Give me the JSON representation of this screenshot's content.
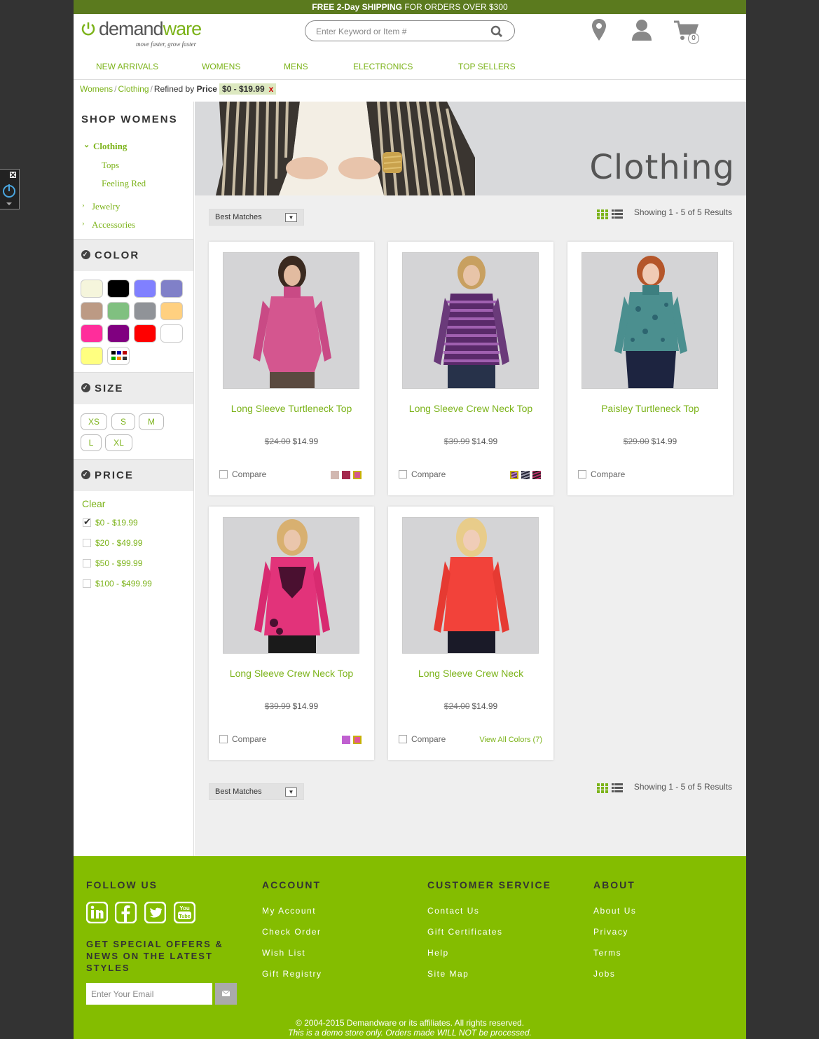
{
  "promo": {
    "bold": "FREE 2-Day SHIPPING",
    "rest": " FOR ORDERS OVER $300"
  },
  "logo": {
    "word_a": "demand",
    "word_b": "ware",
    "tagline": "move faster, grow faster"
  },
  "search": {
    "placeholder": "Enter Keyword or Item #"
  },
  "cart": {
    "count": "0"
  },
  "nav": [
    "NEW ARRIVALS",
    "WOMENS",
    "MENS",
    "ELECTRONICS",
    "TOP SELLERS"
  ],
  "breadcrumb": {
    "c1": "Womens",
    "c2": "Clothing",
    "refined": "Refined by",
    "by": "Price",
    "chip": "$0 - $19.99",
    "chip_x": "x"
  },
  "sidebar": {
    "shop_title": "SHOP WOMENS",
    "categories": {
      "clothing": "Clothing",
      "tops": "Tops",
      "feeling_red": "Feeling Red",
      "jewelry": "Jewelry",
      "accessories": "Accessories"
    },
    "color_title": "COLOR",
    "size_title": "SIZE",
    "sizes": [
      "XS",
      "S",
      "M",
      "L",
      "XL"
    ],
    "price_title": "PRICE",
    "price_clear": "Clear",
    "prices": [
      "$0 - $19.99",
      "$20 - $49.99",
      "$50 - $99.99",
      "$100 - $499.99"
    ]
  },
  "colors": [
    "#f5f5dc",
    "#000000",
    "#8080ff",
    "#8080c8",
    "#bc9a84",
    "#80c080",
    "#909398",
    "#ffd080",
    "#ff2d9b",
    "#800080",
    "#ff0000",
    "#ffffff",
    "#ffff80",
    "multi"
  ],
  "banner": {
    "title": "Clothing"
  },
  "sort": {
    "label": "Best Matches"
  },
  "results": "Showing 1 - 5 of 5 Results",
  "products": [
    {
      "name": "Long Sleeve Turtleneck Top",
      "old": "$24.00",
      "price": "$14.99",
      "compare": "Compare"
    },
    {
      "name": "Long Sleeve Crew Neck Top",
      "old": "$39.99",
      "price": "$14.99",
      "compare": "Compare"
    },
    {
      "name": "Paisley Turtleneck Top",
      "old": "$29.00",
      "price": "$14.99",
      "compare": "Compare"
    },
    {
      "name": "Long Sleeve Crew Neck Top",
      "old": "$39.99",
      "price": "$14.99",
      "compare": "Compare"
    },
    {
      "name": "Long Sleeve Crew Neck",
      "old": "$24.00",
      "price": "$14.99",
      "compare": "Compare",
      "view_all": "View All Colors (7)"
    }
  ],
  "footer": {
    "follow": "FOLLOW US",
    "offers": "GET SPECIAL OFFERS & NEWS ON THE LATEST STYLES",
    "email_placeholder": "Enter Your Email",
    "account": {
      "title": "ACCOUNT",
      "links": [
        "My Account",
        "Check Order",
        "Wish List",
        "Gift Registry"
      ]
    },
    "service": {
      "title": "CUSTOMER SERVICE",
      "links": [
        "Contact Us",
        "Gift Certificates",
        "Help",
        "Site Map"
      ]
    },
    "about": {
      "title": "ABOUT",
      "links": [
        "About Us",
        "Privacy",
        "Terms",
        "Jobs"
      ]
    },
    "copyright": "© 2004-2015 Demandware or its affiliates. All rights reserved.",
    "disclaimer": "This is a demo store only. Orders made WILL NOT be processed."
  }
}
